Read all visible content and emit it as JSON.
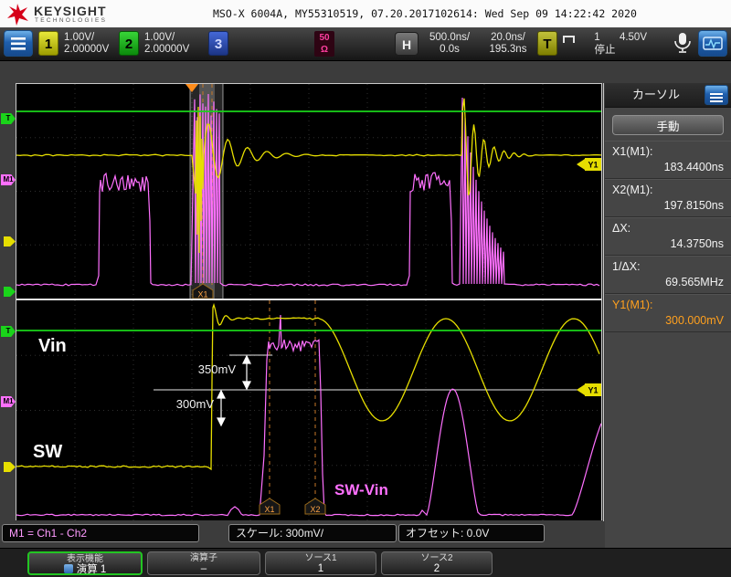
{
  "theme": {
    "ch1_yellow": "#e6de00",
    "ch2_green": "#1ad41a",
    "ch3_blue": "#3a5fd0",
    "math_pink": "#ff70ff",
    "cursor_orange": "#ffa01e",
    "accent_blue": "#3f8fd6"
  },
  "titlebar": {
    "brand": "KEYSIGHT",
    "brand_sub": "TECHNOLOGIES",
    "title": "MSO-X 6004A, MY55310519, 07.20.2017102614: Wed Sep 09 14:22:42 2020"
  },
  "toolbar": {
    "ch1": {
      "num": "1",
      "scale": "1.00V/",
      "offset": "2.00000V"
    },
    "ch2": {
      "num": "2",
      "scale": "1.00V/",
      "offset": "2.00000V"
    },
    "ch3": {
      "num": "3"
    },
    "impedance": {
      "value": "50",
      "unit": "Ω"
    },
    "horizontal": {
      "label": "H",
      "main_scale": "500.0ns/",
      "main_delay": "0.0s",
      "zoom_scale": "20.0ns/",
      "zoom_delay": "195.3ns"
    },
    "trigger": {
      "label": "T",
      "icon": "pulse-width-icon",
      "source": "1",
      "level": "4.50V",
      "status": "停止"
    }
  },
  "scope": {
    "markers": {
      "trigger": "T",
      "math": "M1"
    },
    "top": {
      "x1_flag": "X1",
      "y1_flag": "Y1"
    },
    "bottom": {
      "vin_label": "Vin",
      "sw_label": "SW",
      "swvin_label": "SW-Vin",
      "ann_350": "350mV",
      "ann_300": "300mV",
      "x1_flag": "X1",
      "x2_flag": "X2",
      "y1_flag": "Y1"
    }
  },
  "sidebar": {
    "title": "カーソル",
    "mode": "手動",
    "rows": [
      {
        "label": "X1(M1):",
        "value": "183.4400ns"
      },
      {
        "label": "X2(M1):",
        "value": "197.8150ns"
      },
      {
        "label": "ΔX:",
        "value": "14.3750ns"
      },
      {
        "label": "1/ΔX:",
        "value": "69.565MHz"
      },
      {
        "label": "Y1(M1):",
        "value": "300.000mV"
      }
    ]
  },
  "statusbar": {
    "math": "M1 = Ch1 - Ch2",
    "scale": "スケール: 300mV/",
    "offset": "オフセット: 0.0V"
  },
  "menubar": {
    "items": [
      {
        "top": "表示機能",
        "value": "演算 1"
      },
      {
        "top": "演算子",
        "value": "–"
      },
      {
        "top": "ソース1",
        "value": "1"
      },
      {
        "top": "ソース2",
        "value": "2"
      }
    ]
  }
}
